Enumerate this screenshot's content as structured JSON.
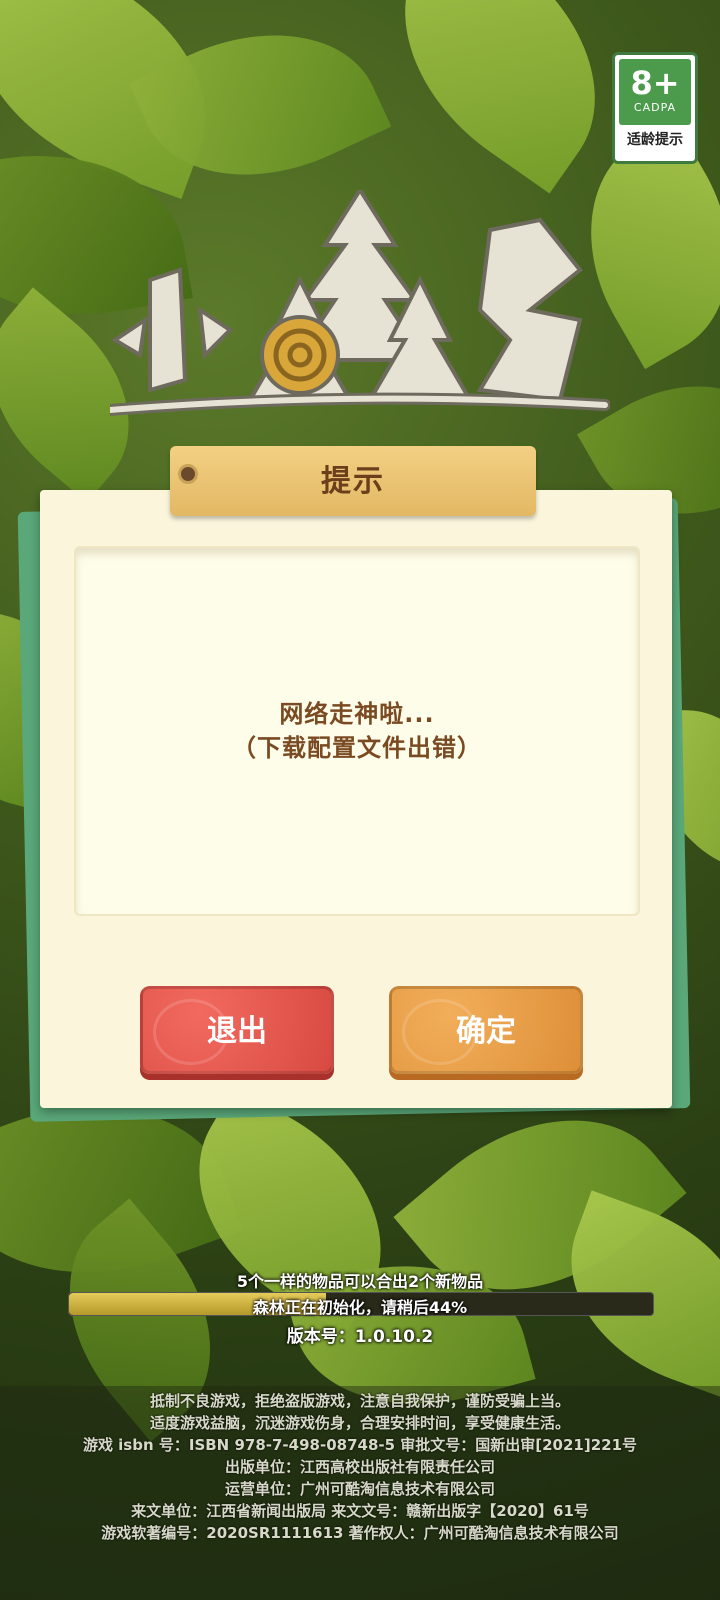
{
  "age_badge": {
    "age": "8+",
    "org": "CADPA",
    "label": "适龄提示"
  },
  "dialog": {
    "title": "提示",
    "message_line1": "网络走神啦...",
    "message_line2": "（下载配置文件出错）",
    "exit_label": "退出",
    "confirm_label": "确定"
  },
  "loading": {
    "tip": "5个一样的物品可以合出2个新物品",
    "status": "森林正在初始化，请稍后44%",
    "progress": 0.44,
    "version": "版本号：1.0.10.2"
  },
  "legal": [
    "抵制不良游戏，拒绝盗版游戏，注意自我保护，谨防受骗上当。",
    "适度游戏益脑，沉迷游戏伤身，合理安排时间，享受健康生活。",
    "游戏 isbn 号：ISBN 978-7-498-08748-5 审批文号：国新出审[2021]221号",
    "出版单位：江西高校出版社有限责任公司",
    "运营单位：广州可酷淘信息技术有限公司",
    "来文单位：江西省新闻出版局 来文文号：赣新出版字【2020】61号",
    "游戏软著编号：2020SR1111613 著作权人：广州可酷淘信息技术有限公司"
  ]
}
